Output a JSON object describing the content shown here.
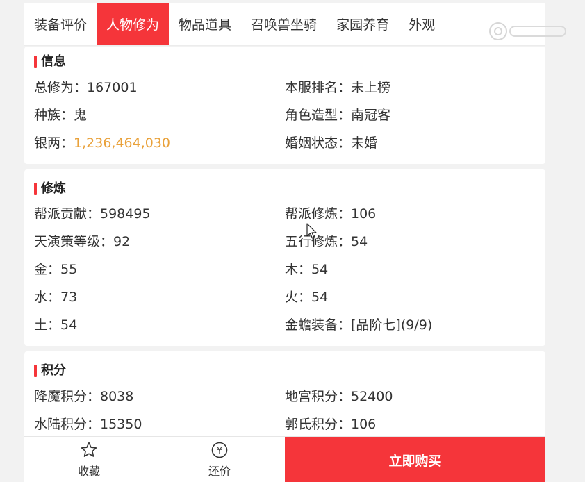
{
  "tabs": [
    {
      "label": "装备评价",
      "active": false
    },
    {
      "label": "人物修为",
      "active": true
    },
    {
      "label": "物品道具",
      "active": false
    },
    {
      "label": "召唤兽坐骑",
      "active": false
    },
    {
      "label": "家园养育",
      "active": false
    },
    {
      "label": "外观",
      "active": false
    }
  ],
  "info": {
    "title": "信息",
    "total_cultivation": "总修为：167001",
    "server_rank": "本服排名：未上榜",
    "race": "种族：鬼",
    "character_model": "角色造型：南冠客",
    "silver_label": "银两：",
    "silver_value": "1,236,464,030",
    "marital_status": "婚姻状态：未婚"
  },
  "training": {
    "title": "修炼",
    "gang_contribution": "帮派贡献：598495",
    "gang_training": "帮派修炼：106",
    "tianyan_level": "天演策等级：92",
    "five_elements": "五行修炼：54",
    "metal": "金：55",
    "wood": "木：54",
    "water": "水：73",
    "fire": "火：54",
    "earth": "土：54",
    "golden_toad": "金蟾装备：[品阶七](9/9)"
  },
  "points": {
    "title": "积分",
    "demon_points": "降魔积分：8038",
    "palace_points": "地宫积分：52400",
    "land_water_points": "水陆积分：15350",
    "guo_points": "郭氏积分：106"
  },
  "bottom": {
    "favorite": "收藏",
    "bargain": "还价",
    "bargain_icon_char": "¥",
    "buy_now": "立即购买"
  },
  "colors": {
    "accent": "#f5353a",
    "silver_value": "#e9a13a"
  }
}
